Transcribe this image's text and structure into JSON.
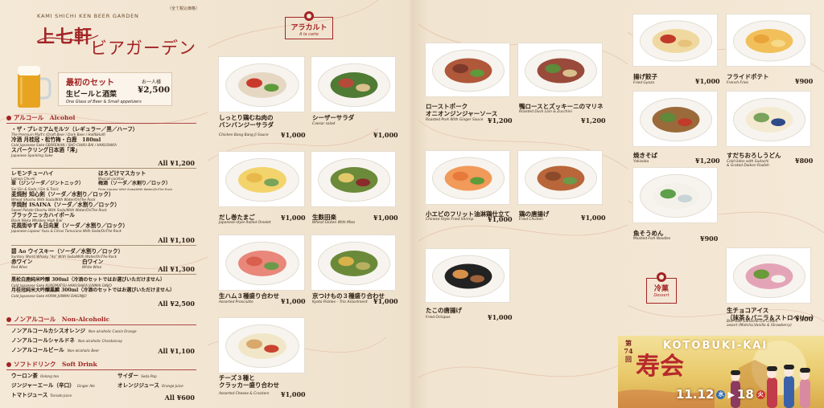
{
  "brand": "KAMI SHICHI KEN BEER GARDEN",
  "tax_note": "（全て税込価格）",
  "logo_line1": "上七軒",
  "logo_line2": "ビアガーデン",
  "first_set": {
    "title": "最初のセット",
    "per_person": "お一人様",
    "name": "生ビールと酒菜",
    "price": "¥2,500",
    "en": "One Glass of Beer & Small appetizers"
  },
  "alcohol": {
    "header": "アルコール　Alcohol",
    "groups": [
      {
        "items": [
          {
            "jp": "・ザ・プレミアムモルツ（レギュラー／黒／ハーフ）",
            "en": "The Premium Malt's (Draft Beer / Dark Beer / Half&Half)"
          },
          {
            "jp": "冷酒 月桂冠・松竹梅・白鹿　180ml",
            "en": "Cold Japanese Sake GEKKEIKAN / SHO CHIKU BAI / HAKUSHIKA"
          },
          {
            "jp": "スパークリング日本酒「澪」",
            "en": "Japanese Sparkling Sake"
          }
        ],
        "price": "All ¥1,200"
      },
      {
        "items": [
          {
            "jp": "レモンチューハイ",
            "en": "Lemon Chu-Hi",
            "jp2": "ほろどけマスカット",
            "en2": "Muscat cocktail"
          },
          {
            "jp": "翠（ジンソーダ／ジントニック）",
            "en": "Sui Gin & Soda / Gin & Tonic",
            "jp2": "梅酒（ソーダ／水割り／ロック）",
            "en2": "Plum Liqueur With Soda/With Water/OnThe Rock"
          },
          {
            "jp": "麦焼酎 知心剣（ソーダ／水割り／ロック）",
            "en": "Wheat Shochu With Soda/With Water/OnThe Rock"
          },
          {
            "jp": "芋焼酎 ISAINA（ソーダ／水割り／ロック）",
            "en": "Sweet Potato Shochu With Soda/With Water/OnThe Rock"
          },
          {
            "jp": "ブラックニッカハイボール",
            "en": "Black Nikka Whiskey High Ball"
          },
          {
            "jp": "花風街ゆず＆日向夏（ソーダ／水割り／ロック）",
            "en": "Japanese Liqueur Yuzu & Citrus Tamurana With Soda/OnThe Rock"
          }
        ],
        "price": "All ¥1,100"
      },
      {
        "items": [
          {
            "jp": "碧 Ao ウイスキー（ソーダ／水割り／ロック）",
            "en": "Suntory World Whisky \"Ao\" With Soda/With Water/OnThe Rock"
          },
          {
            "jp": "赤ワイン",
            "en": "Red Wine",
            "jp2": "白ワイン",
            "en2": "White Wine"
          }
        ],
        "price": "All ¥1,300"
      },
      {
        "items": [
          {
            "jp": "黒松白鹿純米吟醸 300ml（冷酒のセットではお選びいただけません）",
            "en": "Cold Japanese Sake KUROMATSU-HAKUSHIKA JUNMAI GINJO"
          },
          {
            "jp": "月桂冠純米大吟醸鳳麟 300ml（冷酒のセットではお選びいただけません）",
            "en": "Cold Japanese Sake HORIN JUNMAI DAIGINJO"
          }
        ],
        "price": "All ¥2,500"
      }
    ]
  },
  "non_alcoholic": {
    "header": "ノンアルコール　Non-Alcoholic",
    "items": [
      {
        "jp": "ノンアルコールカシスオレンジ",
        "en": "Non-alcoholic Cassis Orange"
      },
      {
        "jp": "ノンアルコールシャルドネ",
        "en": "Non-alcoholic Chardonnay"
      },
      {
        "jp": "ノンアルコールビール",
        "en": "Non-alcoholic Beer"
      }
    ],
    "price": "All ¥1,100"
  },
  "soft_drink": {
    "header": "ソフトドリンク　Soft Drink",
    "rows": [
      {
        "jp": "ウーロン茶",
        "en": "Oolong tea",
        "jp2": "サイダー",
        "en2": "Soda Pop"
      },
      {
        "jp": "ジンジャーエール（辛口）",
        "en": "Ginger Ale",
        "jp2": "オレンジジュース",
        "en2": "Orange Juice"
      },
      {
        "jp": "トマトジュース",
        "en": "Tomato Juice"
      }
    ],
    "price": "All ¥600"
  },
  "alacarte_badge": {
    "jp": "アラカルト",
    "en": "A la carte"
  },
  "dessert_badge": {
    "jp": "冷菓",
    "en": "Dessert"
  },
  "dishes": [
    {
      "jp": "しっとり鶏むね肉の\nバンバンジーサラダ",
      "en": "Chicken Bang Bang Ji Sauce",
      "price": "¥1,000"
    },
    {
      "jp": "シーザーサラダ",
      "en": "Caesar salad",
      "price": "¥1,000"
    },
    {
      "jp": "だし巻たまご",
      "en": "Japanese-style Rolled Omelet",
      "price": "¥1,000"
    },
    {
      "jp": "生麩田楽",
      "en": "Wheat Gluten With Miso",
      "price": "¥1,000"
    },
    {
      "jp": "生ハム３種盛り合わせ",
      "en": "Assorted Prosciutto",
      "price": "¥1,000"
    },
    {
      "jp": "京つけもの３種盛り合わせ",
      "en": "Kyoto Pickles – Trio Assortment",
      "price": "¥1,000"
    },
    {
      "jp": "チーズ３種と\nクラッカー盛り合わせ",
      "en": "Assorted Cheese & Crackers",
      "price": "¥1,000"
    },
    {
      "jp": "ローストポーク\nオニオンジンジャーソース",
      "en": "Roasted Pork With Ginger Sauce",
      "price": "¥1,200"
    },
    {
      "jp": "鴨ロースとズッキーニのマリネ",
      "en": "Roasted Duck Loin & Zucchini",
      "price": "¥1,200"
    },
    {
      "jp": "小エビのフリット油淋鶏仕立て",
      "en": "Chinese Style Fried Shrimp",
      "price": "¥1,000"
    },
    {
      "jp": "鶏の唐揚げ",
      "en": "Fried Chicken",
      "price": "¥1,000"
    },
    {
      "jp": "たこの唐揚げ",
      "en": "Fried Octopus",
      "price": "¥1,000"
    },
    {
      "jp": "揚げ餃子",
      "en": "Fried Gyoza",
      "price": "¥1,000"
    },
    {
      "jp": "フライドポテト",
      "en": "French Fries",
      "price": "¥900"
    },
    {
      "jp": "焼きそば",
      "en": "Yakisoba",
      "price": "¥1,200"
    },
    {
      "jp": "すだちおろしうどん",
      "en": "Cold Udon with Sudachi\n& Grated Daikon Radish",
      "price": "¥800"
    },
    {
      "jp": "魚そうめん",
      "en": "Mashed Fish Noodles",
      "price": "¥900"
    },
    {
      "jp": "生チョコアイス\n（抹茶＆バニラ＆ストロベリー）",
      "en": "Bite-size Ganache-Ice Cream\nassort (Matcha,Vanilla & Strawberry)",
      "price": "¥900"
    }
  ],
  "kotobuki": {
    "no": "第74回",
    "title": "KOTOBUKI-KAI",
    "kanji": "寿会",
    "date_start": "11.12",
    "day_start": "水",
    "date_end": "18",
    "day_end": "火"
  },
  "colors": {
    "accent": "#a22424",
    "background": "#f4e8d6"
  }
}
